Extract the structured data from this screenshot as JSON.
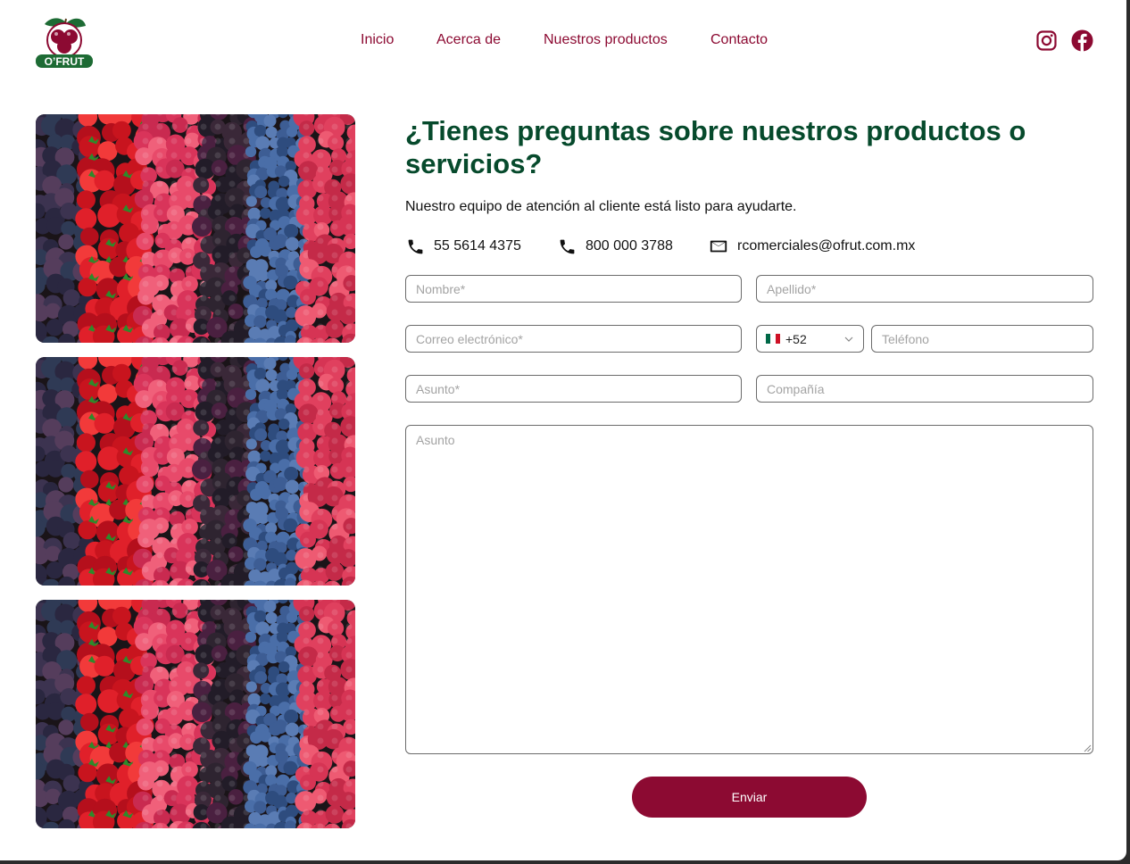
{
  "brand": {
    "logo_text": "O’FRUT"
  },
  "nav": {
    "items": [
      {
        "label": "Inicio"
      },
      {
        "label": "Acerca de"
      },
      {
        "label": "Nuestros productos"
      },
      {
        "label": "Contacto"
      }
    ]
  },
  "social": {
    "icons": [
      "instagram-icon",
      "facebook-icon"
    ]
  },
  "gallery": {
    "images": [
      "berries-photo",
      "berries-photo",
      "berries-photo"
    ]
  },
  "contact_section": {
    "heading": "¿Tienes preguntas sobre nuestros productos o servicios?",
    "subtitle": "Nuestro equipo de atención al cliente está listo para ayudarte.",
    "phone_1": "55 5614 4375",
    "phone_2": "800 000 3788",
    "email": "rcomerciales@ofrut.com.mx"
  },
  "form": {
    "nombre_placeholder": "Nombre*",
    "apellido_placeholder": "Apellido*",
    "correo_placeholder": "Correo electrónico*",
    "country_code": "+52",
    "telefono_placeholder": "Teléfono",
    "asunto_placeholder": "Asunto*",
    "compania_placeholder": "Compañía",
    "mensaje_placeholder": "Asunto",
    "submit_label": "Enviar"
  },
  "colors": {
    "brand_red": "#8c0a32",
    "heading_green": "#064a2c",
    "logo_green": "#1d6b34"
  }
}
